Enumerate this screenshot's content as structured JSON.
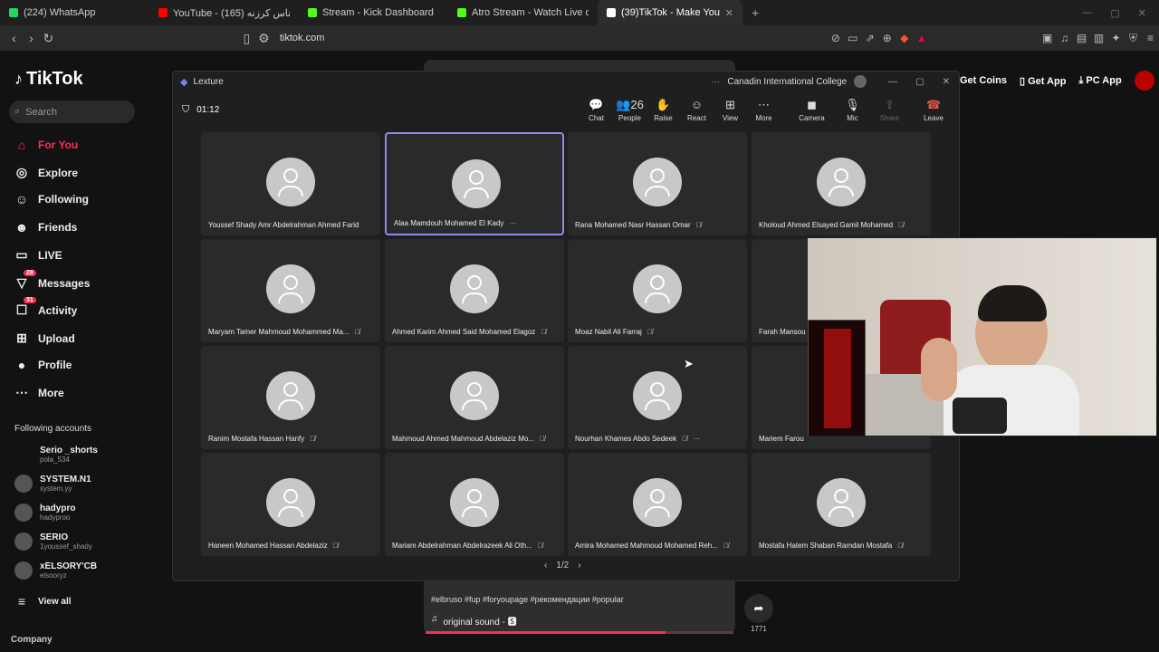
{
  "browser": {
    "tabs": [
      {
        "title": "(224) WhatsApp",
        "color": "#25d366"
      },
      {
        "title": "YouTube - (165) يا ناس كرزنه",
        "color": "#ff0000"
      },
      {
        "title": "Stream - Kick Dashboard",
        "color": "#53fc18"
      },
      {
        "title": "Atro Stream - Watch Live on Kick",
        "color": "#53fc18"
      },
      {
        "title": "(39)TikTok - Make Your Day",
        "color": "#ffffff"
      }
    ],
    "url": "tiktok.com"
  },
  "tiktok": {
    "logo": "TikTok",
    "search_placeholder": "Search",
    "nav": [
      {
        "label": "For You",
        "icon": "home-icon",
        "glyph": "⌂",
        "badge": ""
      },
      {
        "label": "Explore",
        "icon": "compass-icon",
        "glyph": "◎",
        "badge": ""
      },
      {
        "label": "Following",
        "icon": "person-icon",
        "glyph": "☺",
        "badge": ""
      },
      {
        "label": "Friends",
        "icon": "friends-icon",
        "glyph": "☻",
        "badge": ""
      },
      {
        "label": "LIVE",
        "icon": "live-icon",
        "glyph": "▭",
        "badge": ""
      },
      {
        "label": "Messages",
        "icon": "messages-icon",
        "glyph": "▽",
        "badge": "28"
      },
      {
        "label": "Activity",
        "icon": "activity-icon",
        "glyph": "☐",
        "badge": "31"
      },
      {
        "label": "Upload",
        "icon": "upload-icon",
        "glyph": "⊞",
        "badge": ""
      },
      {
        "label": "Profile",
        "icon": "profile-icon",
        "glyph": "●",
        "badge": ""
      },
      {
        "label": "More",
        "icon": "more-icon",
        "glyph": "⋯",
        "badge": ""
      }
    ],
    "following_title": "Following accounts",
    "accounts": [
      {
        "name": "Serio _shorts",
        "handle": "pola_534"
      },
      {
        "name": "SYSTEM.N1",
        "handle": "system.yy"
      },
      {
        "name": "hadypro",
        "handle": "hadyproo"
      },
      {
        "name": "SERIO",
        "handle": "1youssef_shady"
      },
      {
        "name": "xELSORY'CB",
        "handle": "elsooryz"
      }
    ],
    "view_all": "View all",
    "company": "Company",
    "get_coins": "Get Coins",
    "get_app": "Get App",
    "pc_app": "PC App",
    "video_tags": "#elbruso #fup #foryoupage #рекомендации #popular",
    "video_sound": "original sound - 🆂",
    "share_count": "1771",
    "video_progress": 0.78
  },
  "teams": {
    "app_name": "Lexture",
    "org": "Canadin International College",
    "timer": "01:12",
    "toolbar": [
      {
        "label": "Chat",
        "icon": "chat-icon",
        "glyph": "💬"
      },
      {
        "label": "People",
        "icon": "people-icon",
        "glyph": "👥26"
      },
      {
        "label": "Raise",
        "icon": "raise-hand-icon",
        "glyph": "✋"
      },
      {
        "label": "React",
        "icon": "react-icon",
        "glyph": "☺"
      },
      {
        "label": "View",
        "icon": "view-grid-icon",
        "glyph": "⊞"
      },
      {
        "label": "More",
        "icon": "more-icon",
        "glyph": "⋯"
      },
      {
        "label": "Camera",
        "icon": "camera-off-icon",
        "glyph": "◼"
      },
      {
        "label": "Mic",
        "icon": "mic-icon",
        "glyph": "🎙"
      },
      {
        "label": "Share",
        "icon": "share-icon",
        "glyph": "⇪"
      },
      {
        "label": "Leave",
        "icon": "leave-icon",
        "glyph": "☎"
      }
    ],
    "participants": [
      {
        "name": "Youssef Shady Amr Abdelrahman Ahmed Farid",
        "muted": false,
        "extra": ""
      },
      {
        "name": "Alaa Mamdouh Mohamed El Kady",
        "muted": false,
        "extra": "···"
      },
      {
        "name": "Rana Mohamed Nasr Hassan Omar",
        "muted": true,
        "extra": ""
      },
      {
        "name": "Kholoud Ahmed Elsayed Gamil Mohamed",
        "muted": true,
        "extra": ""
      },
      {
        "name": "Maryam Tamer Mahmoud Mohammed Ma...",
        "muted": true,
        "extra": ""
      },
      {
        "name": "Ahmed Karim Ahmed Said Mohamed Elagoz",
        "muted": true,
        "extra": ""
      },
      {
        "name": "Moaz Nabil Ali Farraj",
        "muted": true,
        "extra": ""
      },
      {
        "name": "Farah Mansou",
        "muted": false,
        "extra": ""
      },
      {
        "name": "Ranim Mostafa Hassan Hanfy",
        "muted": true,
        "extra": ""
      },
      {
        "name": "Mahmoud Ahmed Mahmoud Abdelaziz Mo...",
        "muted": true,
        "extra": ""
      },
      {
        "name": "Nourhan Khames Abdo Sedeek",
        "muted": true,
        "extra": "···"
      },
      {
        "name": "Mariem Farou",
        "muted": false,
        "extra": ""
      },
      {
        "name": "Haneen Mohamed Hassan Abdelaziz",
        "muted": true,
        "extra": ""
      },
      {
        "name": "Mariam Abdelrahman Abdelrazeek Ali Oth...",
        "muted": true,
        "extra": ""
      },
      {
        "name": "Amira Mohamed Mahmoud Mohamed Reh...",
        "muted": true,
        "extra": ""
      },
      {
        "name": "Mostafa Hatem Shaban Ramdan Mostafa",
        "muted": true,
        "extra": ""
      }
    ],
    "selected_index": 1,
    "page": "1/2"
  }
}
